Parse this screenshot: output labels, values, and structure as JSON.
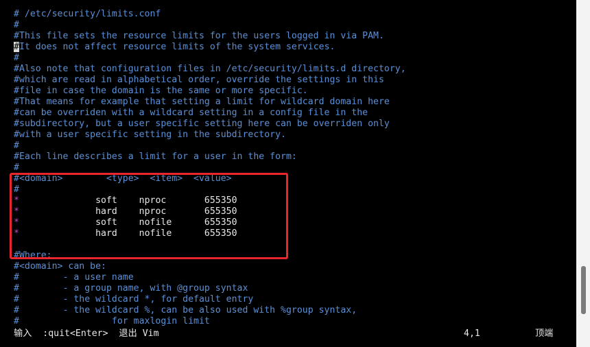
{
  "editor": {
    "lines": [
      "# /etc/security/limits.conf",
      "#",
      "#This file sets the resource limits for the users logged in via PAM.",
      "#It does not affect resource limits of the system services.",
      "#",
      "#Also note that configuration files in /etc/security/limits.d directory,",
      "#which are read in alphabetical order, override the settings in this",
      "#file in case the domain is the same or more specific.",
      "#That means for example that setting a limit for wildcard domain here",
      "#can be overriden with a wildcard setting in a config file in the",
      "#subdirectory, but a user specific setting here can be overriden only",
      "#with a user specific setting in the subdirectory.",
      "#",
      "#Each line describes a limit for a user in the form:",
      "#",
      "#<domain>        <type>  <item>  <value>",
      "#",
      "",
      "",
      "",
      "",
      "",
      "#Where:",
      "#<domain> can be:",
      "#        - a user name",
      "#        - a group name, with @group syntax",
      "#        - the wildcard *, for default entry",
      "#        - the wildcard %, can be also used with %group syntax,",
      "#                 for maxlogin limit"
    ],
    "limits": [
      {
        "star": "*",
        "rest": "              soft    nproc       655350"
      },
      {
        "star": "*",
        "rest": "              hard    nproc       655350"
      },
      {
        "star": "*",
        "rest": "              soft    nofile      655350"
      },
      {
        "star": "*",
        "rest": "              hard    nofile      655350"
      }
    ]
  },
  "status": {
    "message": "输入  :quit<Enter>  退出 Vim",
    "position": "4,1",
    "percent": "顶端"
  },
  "colors": {
    "comment": "#5b8fd6",
    "star": "#c24bc2",
    "text": "#e8e8e8",
    "background": "#000000",
    "highlight": "#e8262c"
  }
}
